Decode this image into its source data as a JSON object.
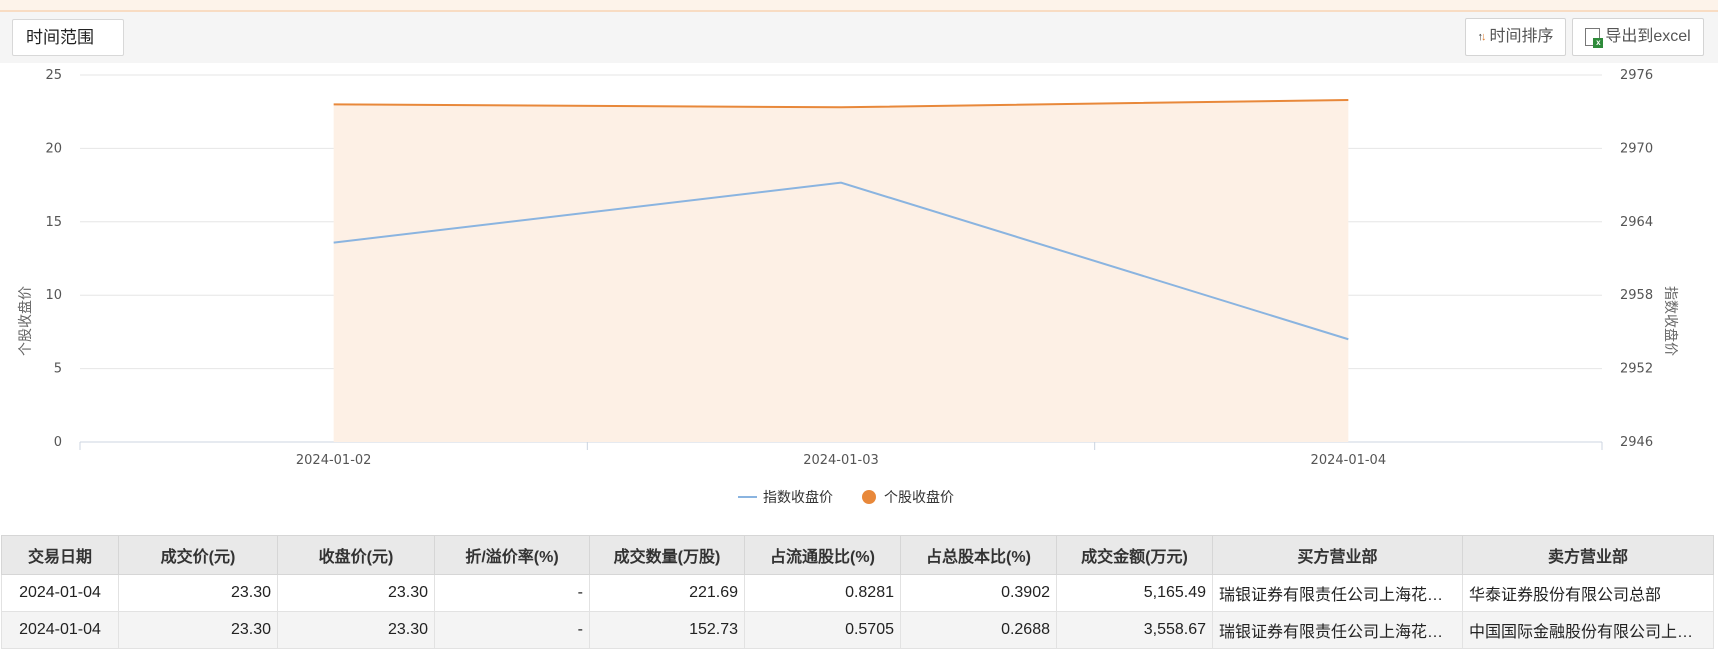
{
  "toolbar": {
    "range_label": "时间范围",
    "sort_label": "时间排序",
    "export_label": "导出到excel"
  },
  "colors": {
    "index_line": "#8ab4e0",
    "stock_line": "#e8883a",
    "stock_fill": "#fdf0e5"
  },
  "chart_data": {
    "type": "line",
    "x": [
      "2024-01-02",
      "2024-01-03",
      "2024-01-04"
    ],
    "series": [
      {
        "name": "指数收盘价",
        "axis": "right",
        "values": [
          2962.3,
          2967.2,
          2954.4
        ]
      },
      {
        "name": "个股收盘价",
        "axis": "left",
        "values": [
          23.0,
          22.8,
          23.3
        ]
      }
    ],
    "ylabel": "个股收盘价",
    "ylabel_right": "指数收盘价",
    "ylim": [
      0,
      25
    ],
    "ylim_right": [
      2946,
      2976
    ],
    "y_ticks": [
      "0",
      "5",
      "10",
      "15",
      "20",
      "25"
    ],
    "y_ticks_right": [
      "2946",
      "2952",
      "2958",
      "2964",
      "2970",
      "2976"
    ],
    "grid": true,
    "legend": "bottom"
  },
  "table": {
    "headers": [
      "交易日期",
      "成交价(元)",
      "收盘价(元)",
      "折/溢价率(%)",
      "成交数量(万股)",
      "占流通股比(%)",
      "占总股本比(%)",
      "成交金额(万元)",
      "买方营业部",
      "卖方营业部"
    ],
    "rows": [
      [
        "2024-01-04",
        "23.30",
        "23.30",
        "-",
        "221.69",
        "0.8281",
        "0.3902",
        "5,165.49",
        "瑞银证券有限责任公司上海花…",
        "华泰证券股份有限公司总部"
      ],
      [
        "2024-01-04",
        "23.30",
        "23.30",
        "-",
        "152.73",
        "0.5705",
        "0.2688",
        "3,558.67",
        "瑞银证券有限责任公司上海花…",
        "中国国际金融股份有限公司上…"
      ]
    ]
  }
}
